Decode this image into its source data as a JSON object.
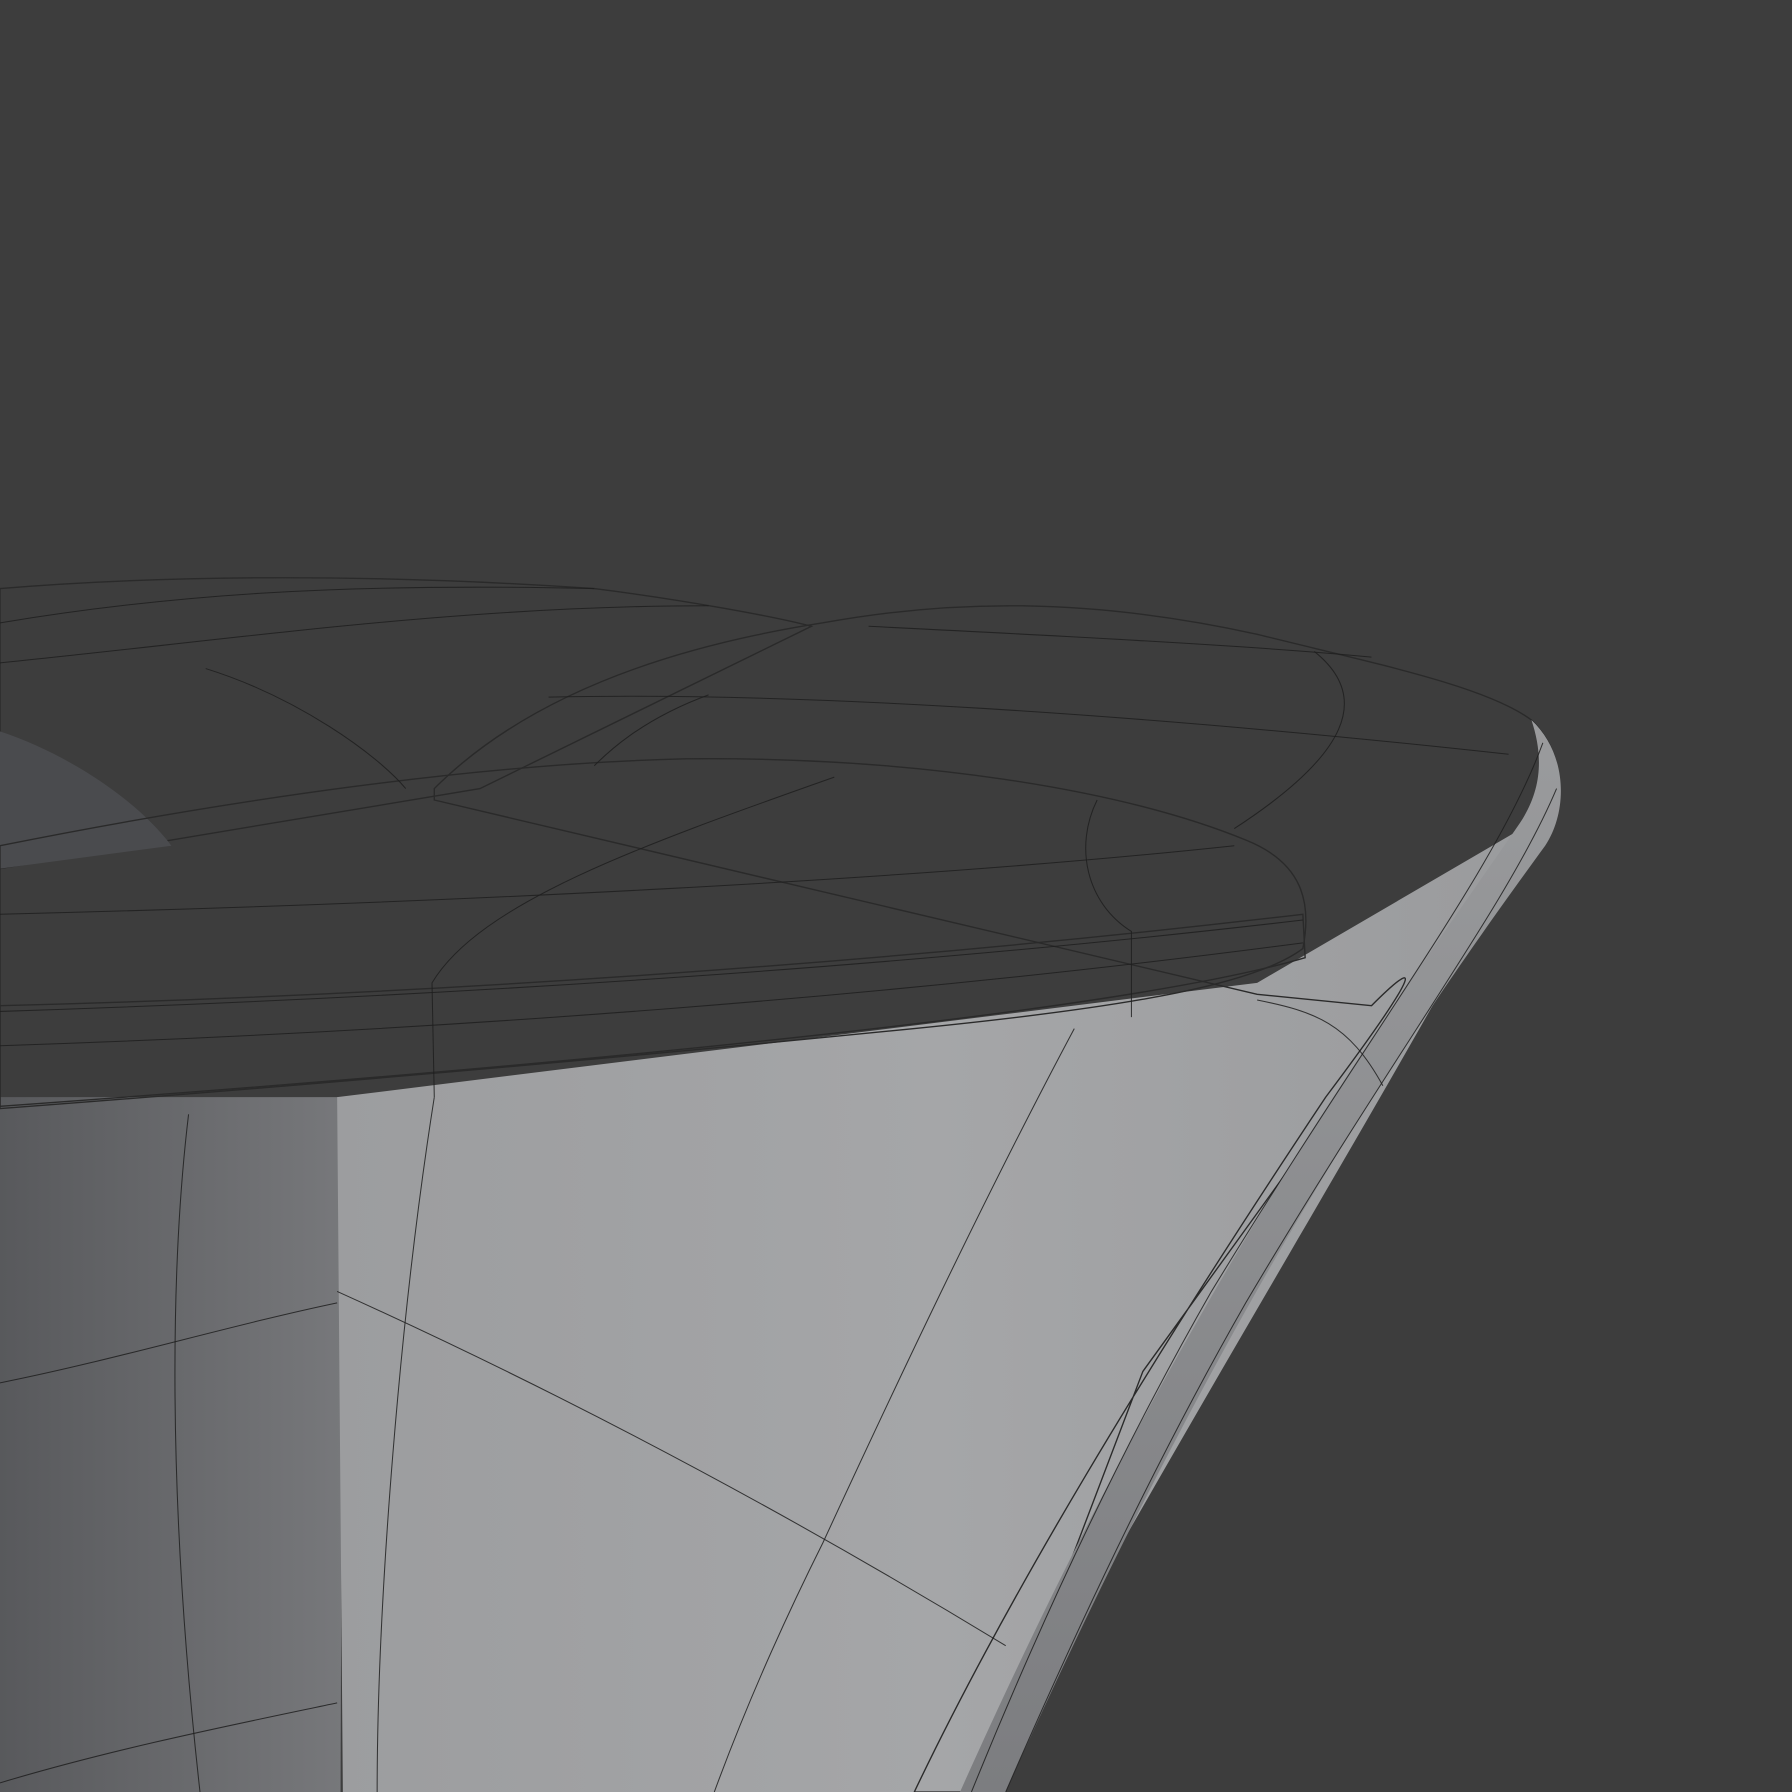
{
  "viewport": {
    "background_color": "#3d3d3d",
    "mesh_light_color": "#a4a5a7",
    "mesh_mid_color": "#8a8b8d",
    "mesh_dark_color": "#58595c",
    "wire_color": "#1e1e1e",
    "shading": "solid",
    "overlay": "wireframe"
  }
}
